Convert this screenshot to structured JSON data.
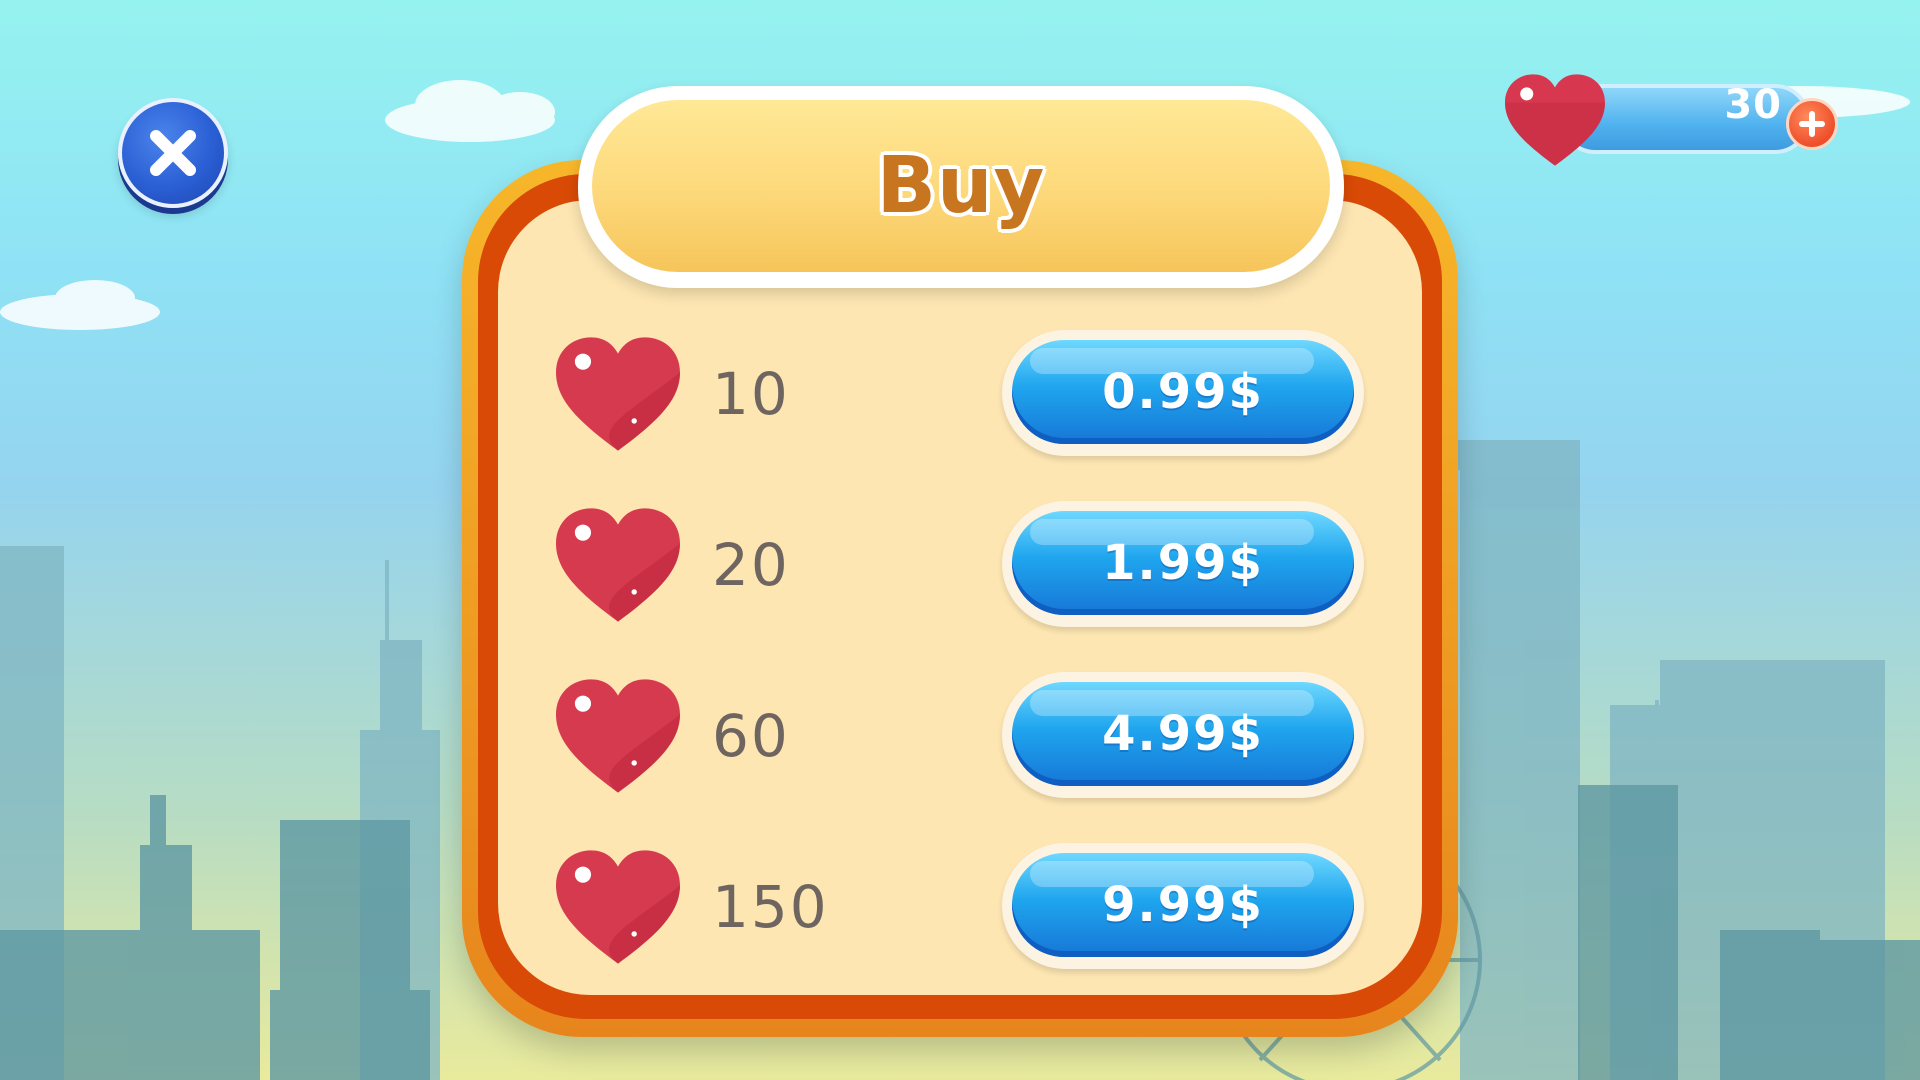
{
  "title": "Buy",
  "hearts_counter": {
    "value": "30",
    "icon": "heart-icon",
    "add_icon": "plus-icon"
  },
  "close_icon": "close-icon",
  "offers": [
    {
      "quantity": "10",
      "price": "0.99$"
    },
    {
      "quantity": "20",
      "price": "1.99$"
    },
    {
      "quantity": "60",
      "price": "4.99$"
    },
    {
      "quantity": "150",
      "price": "9.99$"
    }
  ],
  "colors": {
    "panel_border": "#d94a06",
    "panel_fill": "#fde6b2",
    "title_text": "#c8751f",
    "button_blue": "#1fa5ee",
    "heart_red": "#d63a4f",
    "close_blue": "#2a5fd4"
  }
}
